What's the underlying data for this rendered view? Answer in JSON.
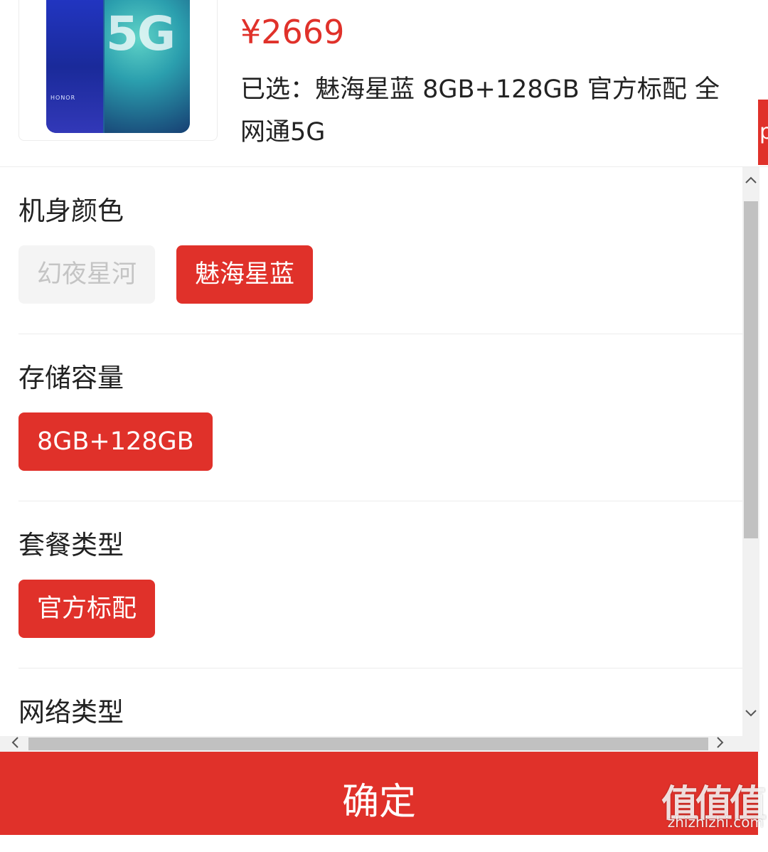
{
  "header": {
    "product_image_alt": "HONOR 5G phone",
    "product_image_text_5g": "5G",
    "product_image_brand": "HONOR",
    "price": "¥2669",
    "selected_line": "已选：魅海星蓝 8GB+128GB 官方标配 全网通5G",
    "side_tab_char": "p"
  },
  "sections": [
    {
      "title": "机身颜色",
      "options": [
        {
          "label": "幻夜星河",
          "state": "disabled"
        },
        {
          "label": "魅海星蓝",
          "state": "active"
        }
      ]
    },
    {
      "title": "存储容量",
      "options": [
        {
          "label": "8GB+128GB",
          "state": "active"
        }
      ]
    },
    {
      "title": "套餐类型",
      "options": [
        {
          "label": "官方标配",
          "state": "active"
        }
      ]
    },
    {
      "title": "网络类型",
      "options": []
    }
  ],
  "scrollbar_icons": {
    "up": "up-arrow-icon",
    "down": "down-arrow-icon",
    "left": "left-arrow-icon",
    "right": "right-arrow-icon"
  },
  "confirm_label": "确定",
  "watermark": {
    "logo": "值值值",
    "domain": "zhizhizhi.com"
  },
  "colors": {
    "accent": "#e0312a",
    "disabled_bg": "#f4f4f4",
    "disabled_text": "#c4c4c4"
  }
}
